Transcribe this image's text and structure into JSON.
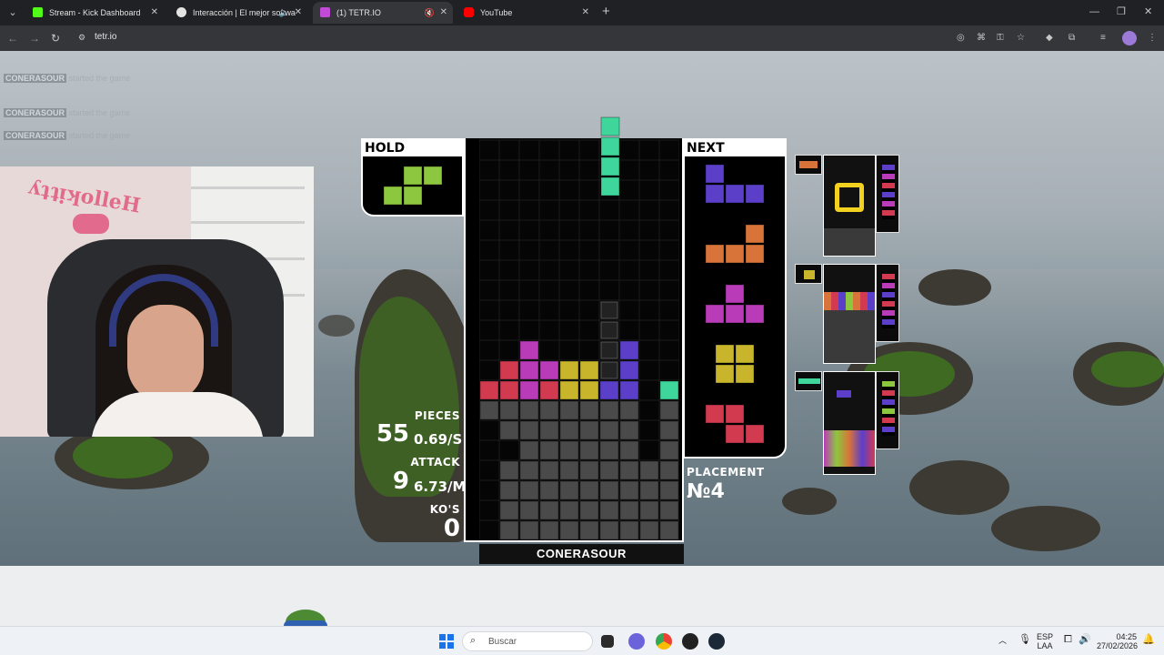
{
  "browser": {
    "tabs": [
      {
        "title": "Stream - Kick Dashboard",
        "favicon": "kick-icon",
        "color": "#53fc18"
      },
      {
        "title": "Interacción | El mejor softwa",
        "favicon": "streamelements-icon",
        "color": "#e3e3e3"
      },
      {
        "title": "(1) TETR.IO",
        "favicon": "tetrio-icon",
        "color": "#c14bd6"
      },
      {
        "title": "YouTube",
        "favicon": "youtube-icon",
        "color": "#ff0000"
      }
    ],
    "url": "tetr.io"
  },
  "game": {
    "hold_label": "HOLD",
    "next_label": "NEXT",
    "player_name": "CONERASOUR",
    "pieces_label": "PIECES",
    "pieces_value": "55",
    "pieces_rate": "0.69/S",
    "attack_label": "ATTACK",
    "attack_value": "9",
    "attack_rate": "6.73/M",
    "kos_label": "KO'S",
    "kos_value": "0",
    "placement_label": "PLACEMENT",
    "placement_value": "№4",
    "hold_piece": "S",
    "next_queue": [
      "J",
      "L",
      "T",
      "O",
      "Z"
    ],
    "colors": {
      "S": "#8dc63f",
      "J": "#5b3fc9",
      "L": "#d8743a",
      "T": "#b93bb8",
      "O": "#c9b52b",
      "Z": "#d23a50",
      "I": "#3fd69b",
      "garbage": "#4a4a4a"
    }
  },
  "chat_ghost": [
    {
      "user": "CONERASOUR",
      "text": "started the game"
    },
    {
      "user": "CONERASOUR",
      "text": "started the game"
    },
    {
      "user": "CONERASOUR",
      "text": "started the game"
    }
  ],
  "taskbar": {
    "search_placeholder": "Buscar",
    "language_top": "ESP",
    "language_bottom": "LAA",
    "time": "04:25",
    "date": "27/02/2026"
  }
}
